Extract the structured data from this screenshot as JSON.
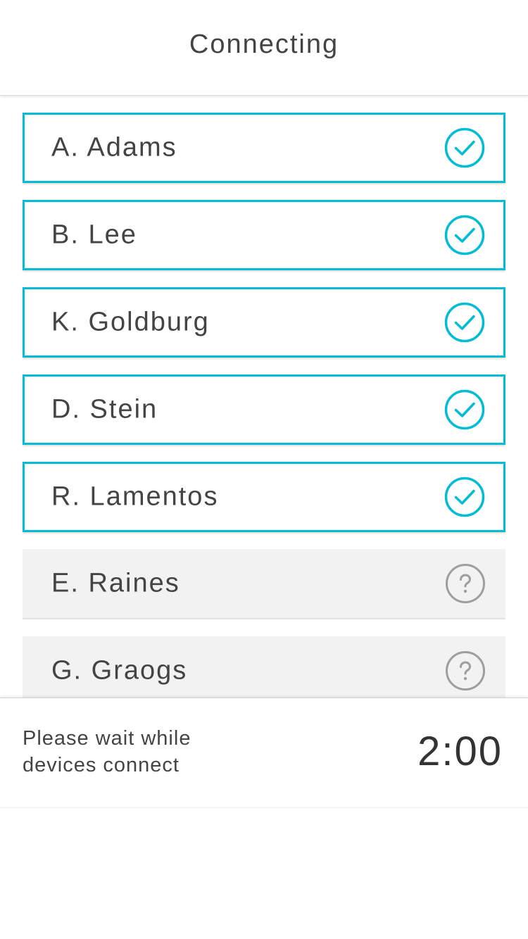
{
  "header": {
    "title": "Connecting"
  },
  "devices": [
    {
      "name": "A. Adams",
      "status": "connected",
      "icon": "check-circle-icon"
    },
    {
      "name": "B. Lee",
      "status": "connected",
      "icon": "check-circle-icon"
    },
    {
      "name": "K. Goldburg",
      "status": "connected",
      "icon": "check-circle-icon"
    },
    {
      "name": "D. Stein",
      "status": "connected",
      "icon": "check-circle-icon"
    },
    {
      "name": "R. Lamentos",
      "status": "connected",
      "icon": "check-circle-icon"
    },
    {
      "name": "E. Raines",
      "status": "waiting",
      "icon": "question-circle-icon"
    },
    {
      "name": "G. Graogs",
      "status": "waiting",
      "icon": "question-circle-icon"
    }
  ],
  "footer": {
    "message": "Please wait while devices connect",
    "timer": "2:00"
  },
  "colors": {
    "connected_accent": "#00bcd4",
    "waiting_icon": "#9e9e9e",
    "waiting_background": "#f2f2f2",
    "text": "#444444"
  }
}
